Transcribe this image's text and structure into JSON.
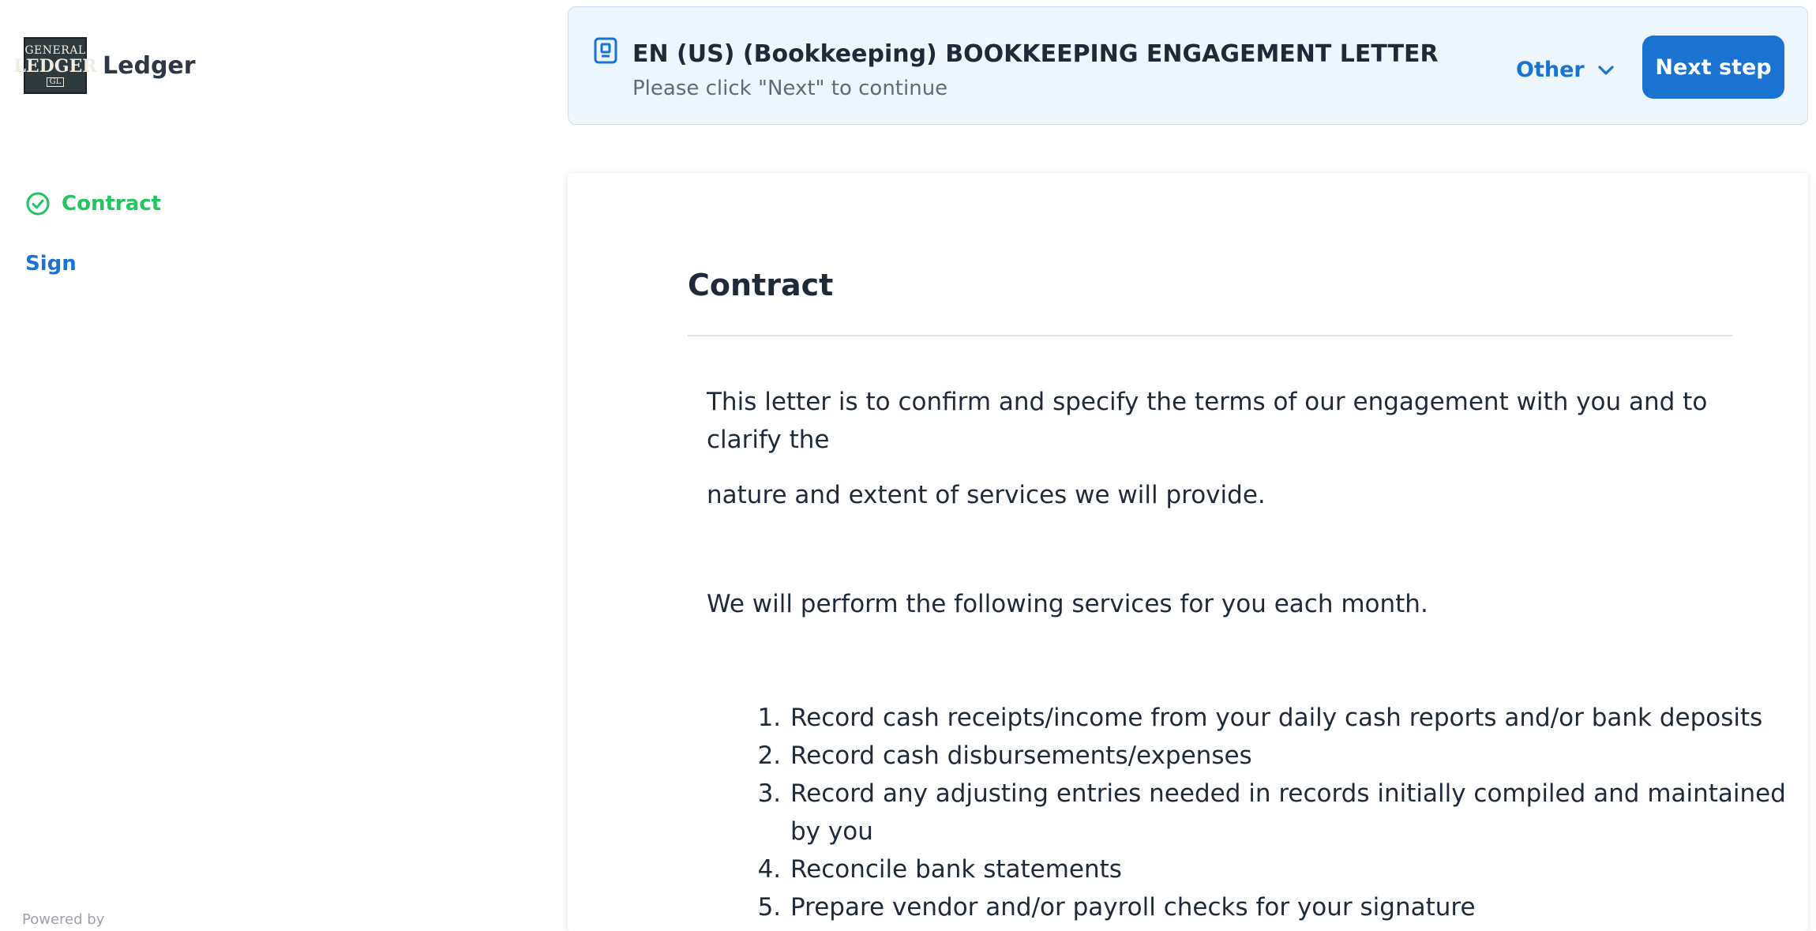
{
  "brand": {
    "logo_text": [
      "GENERAL",
      "LEDGER",
      "GL"
    ],
    "name": "Ledger"
  },
  "nav": {
    "items": [
      {
        "label": "Contract",
        "state": "done"
      },
      {
        "label": "Sign",
        "state": "pending"
      }
    ]
  },
  "footer": {
    "powered_by": "Powered by"
  },
  "header": {
    "icon": "document-icon",
    "title": "EN (US) (Bookkeeping) BOOKKEEPING ENGAGEMENT LETTER",
    "subtitle": "Please click \"Next\" to continue",
    "other_label": "Other",
    "next_label": "Next step"
  },
  "document": {
    "section_title": "Contract",
    "paragraph_1_line_1": "This letter is to confirm and specify the terms of our engagement with you and to clarify the",
    "paragraph_1_line_2": "nature and extent of services we will provide.",
    "paragraph_2": "We will perform the following services for you each month.",
    "services": [
      "Record cash receipts/income from your daily cash reports and/or bank deposits",
      "Record cash disbursements/expenses",
      "Record any adjusting entries needed in records initially compiled and maintained by you",
      "Reconcile bank statements",
      "Prepare vendor and/or payroll checks for your signature"
    ]
  },
  "colors": {
    "accent": "#1a73d0",
    "success": "#22c55e",
    "header_bg": "#eef6fd"
  }
}
